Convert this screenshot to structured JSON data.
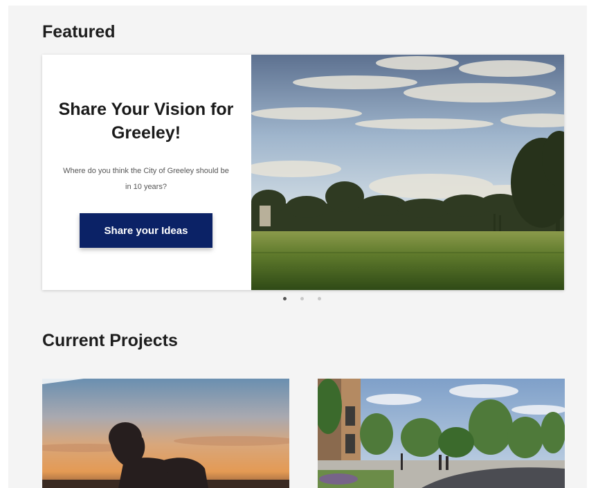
{
  "featured": {
    "section_title": "Featured",
    "card": {
      "heading": "Share Your Vision for Greeley!",
      "description": "Where do you think the City of Greeley should be in 10 years?",
      "button_label": "Share your Ideas",
      "image_alt": "park-landscape-photo"
    },
    "carousel": {
      "slide_count": 3,
      "active_index": 0
    }
  },
  "projects": {
    "section_title": "Current Projects",
    "cards": [
      {
        "image_alt": "silhouette-sunset-photo"
      },
      {
        "image_alt": "street-rendering-image"
      }
    ]
  },
  "colors": {
    "button_bg": "#0b2266",
    "page_bg": "#f4f4f4"
  }
}
